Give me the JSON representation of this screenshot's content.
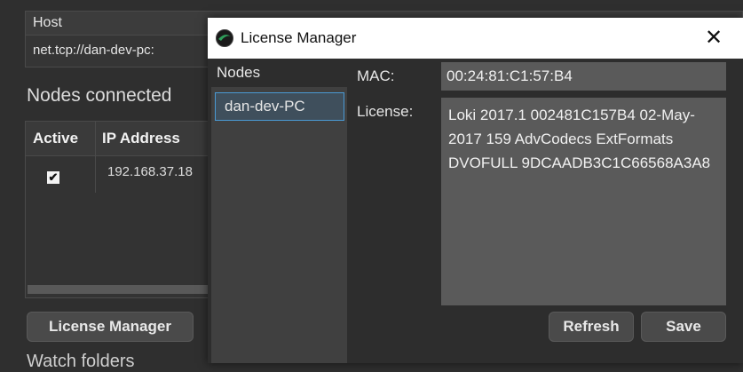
{
  "background": {
    "host_header": "Host",
    "host_value": "net.tcp://dan-dev-pc:",
    "nodes_title": "Nodes connected",
    "table": {
      "columns": [
        "Active",
        "IP Address"
      ],
      "rows": [
        {
          "active": true,
          "check_glyph": "✔",
          "ip": "192.168.37.18"
        }
      ]
    },
    "license_manager_button": "License Manager",
    "watch_folders": "Watch folders"
  },
  "dialog": {
    "title": "License Manager",
    "close_glyph": "✕",
    "nodes_label": "Nodes",
    "nodes": [
      "dan-dev-PC"
    ],
    "mac_label": "MAC:",
    "mac_value": "00:24:81:C1:57:B4",
    "license_label": "License:",
    "license_value": "Loki 2017.1 002481C157B4 02-May-2017 159 AdvCodecs ExtFormats DVOFULL 9DCAADB3C1C66568A3A8",
    "refresh_button": "Refresh",
    "save_button": "Save"
  },
  "colors": {
    "background": "#2f2f2f",
    "field": "#5a5a5a",
    "selection_border": "#4a9ad4"
  },
  "icons": {
    "app": "loki-app-icon",
    "close": "close-icon",
    "checkbox": "checkmark-icon"
  }
}
